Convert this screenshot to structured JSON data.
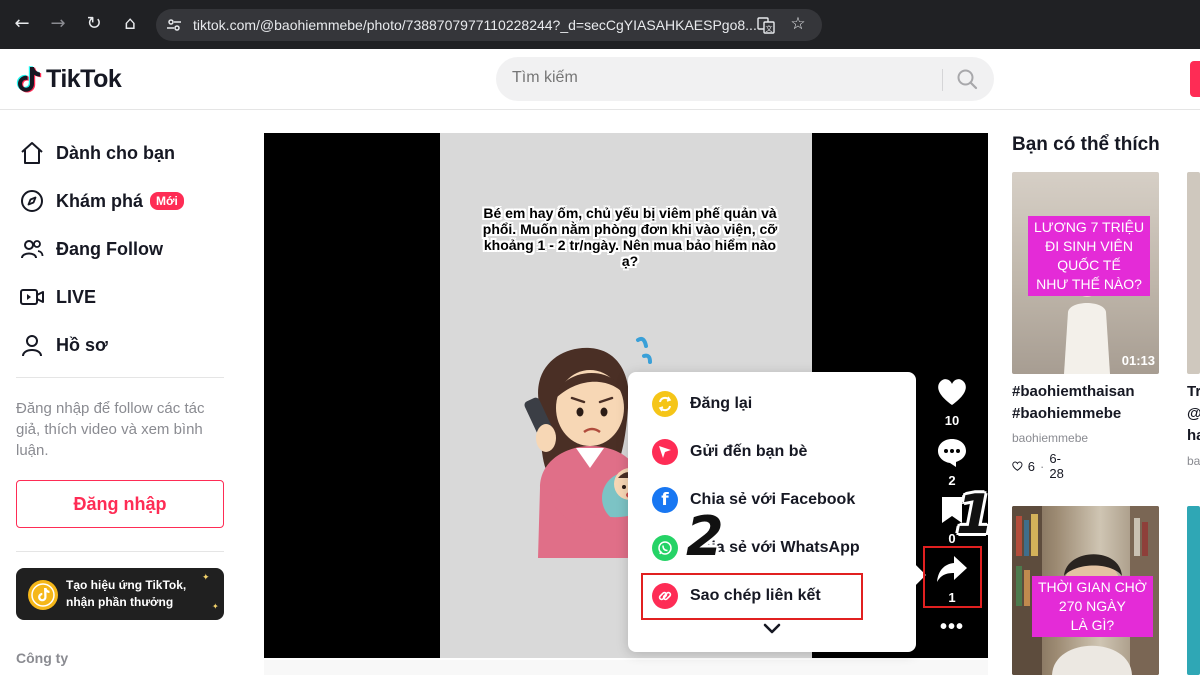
{
  "browser": {
    "url": "tiktok.com/@baohiemmebe/photo/7388707977110228244?_d=secCgYIASAHKAESPgo8...",
    "back_icon": "←",
    "forward_icon": "→",
    "reload_icon": "↻",
    "home_icon": "⌂",
    "star_icon": "☆"
  },
  "header": {
    "logo_text": "TikTok",
    "search_placeholder": "Tìm kiếm"
  },
  "sidebar": {
    "items": [
      {
        "label": "Dành cho bạn",
        "icon": "home-icon"
      },
      {
        "label": "Khám phá",
        "icon": "compass-icon",
        "badge": "Mới"
      },
      {
        "label": "Đang Follow",
        "icon": "following-icon"
      },
      {
        "label": "LIVE",
        "icon": "live-icon"
      },
      {
        "label": "Hồ sơ",
        "icon": "profile-icon"
      }
    ],
    "login_hint": "Đăng nhập để follow các tác giả, thích video và xem bình luận.",
    "login_button": "Đăng nhập",
    "effect_banner_line1": "Tạo hiệu ứng TikTok,",
    "effect_banner_line2": "nhận phần thưởng",
    "company_label": "Công ty"
  },
  "post": {
    "slide_text": "Bé em hay ốm, chủ yếu bị viêm phế quản và phổi. Muốn nằm phòng đơn khi vào viện, cỡ khoảng 1 - 2 tr/ngày. Nên mua bảo hiểm nào ạ?",
    "likes": "10",
    "comments": "2",
    "saves": "0",
    "shares": "1"
  },
  "share_menu": {
    "items": [
      {
        "label": "Đăng lại",
        "color": "#f5c518"
      },
      {
        "label": "Gửi đến bạn bè",
        "color": "#fe2c55"
      },
      {
        "label": "Chia sẻ với Facebook",
        "color": "#1877f2"
      },
      {
        "label": "Chia sẻ với WhatsApp",
        "color": "#25d366"
      },
      {
        "label": "Sao chép liên kết",
        "color": "#fe2c55"
      }
    ]
  },
  "annotations": {
    "step1": "1",
    "step2": "2",
    "highlight_color": "#e12020"
  },
  "suggestions": {
    "title": "Bạn có thể thích",
    "cards": [
      {
        "caption_lines": [
          "LƯƠNG 7 TRIỆU",
          "ĐI SINH VIÊN",
          "QUỐC TẾ",
          "NHƯ THẾ NÀO?"
        ],
        "duration": "01:13",
        "title_line1": "#baohiemthaisan",
        "title_line2": "#baohiemmebe",
        "author": "baohiemmebe",
        "likes": "6",
        "date": "6-28"
      },
      {
        "caption_lines": [
          "THỜI GIAN CHỜ",
          "270 NGÀY",
          "LÀ GÌ?"
        ]
      }
    ],
    "partial_card": {
      "title_line1": "Tr",
      "title_line2": "@",
      "title_line3": "ha",
      "author": "ba"
    }
  }
}
